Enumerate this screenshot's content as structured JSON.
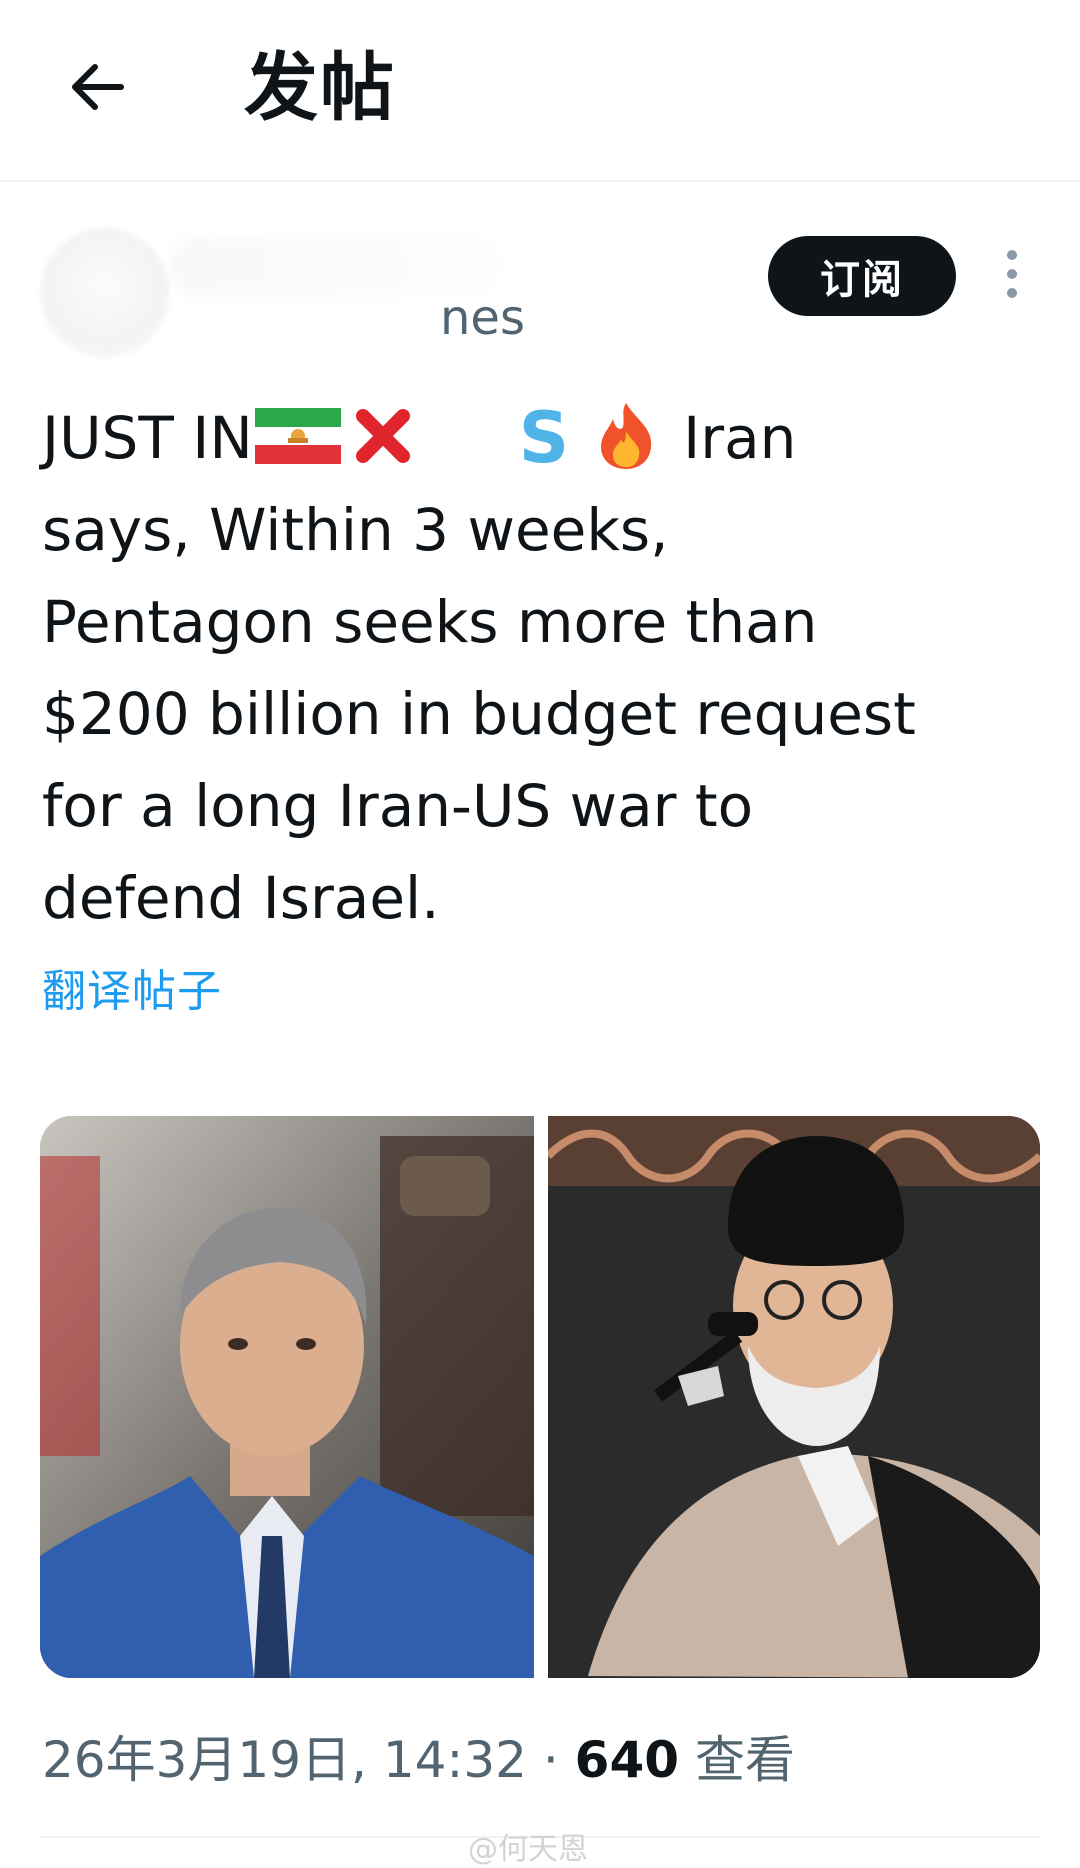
{
  "header": {
    "title": "发帖",
    "back_icon": "arrow-left-icon"
  },
  "author": {
    "handle_fragment": "nes",
    "subscribe_label": "订阅",
    "more_icon": "more-vertical-icon"
  },
  "post": {
    "text_lines": [
      "JUST IN",
      "Iran",
      "says, Within 3 weeks,",
      "Pentagon seeks more than",
      "$200 billion in budget request",
      "for a long Iran-US war to",
      "defend Israel."
    ],
    "emoji_s": "S",
    "translate_label": "翻译帖子"
  },
  "media": [
    {
      "icon": "photo-man-blue-suit"
    },
    {
      "icon": "photo-cleric-microphone"
    }
  ],
  "meta": {
    "timestamp": "26年3月19日, 14:32",
    "separator": "·",
    "views_count": "640",
    "views_label": "查看"
  },
  "watermark": "@何天恩",
  "colors": {
    "accent": "#1d9bf0",
    "text": "#0f1419",
    "muted": "#536471"
  }
}
